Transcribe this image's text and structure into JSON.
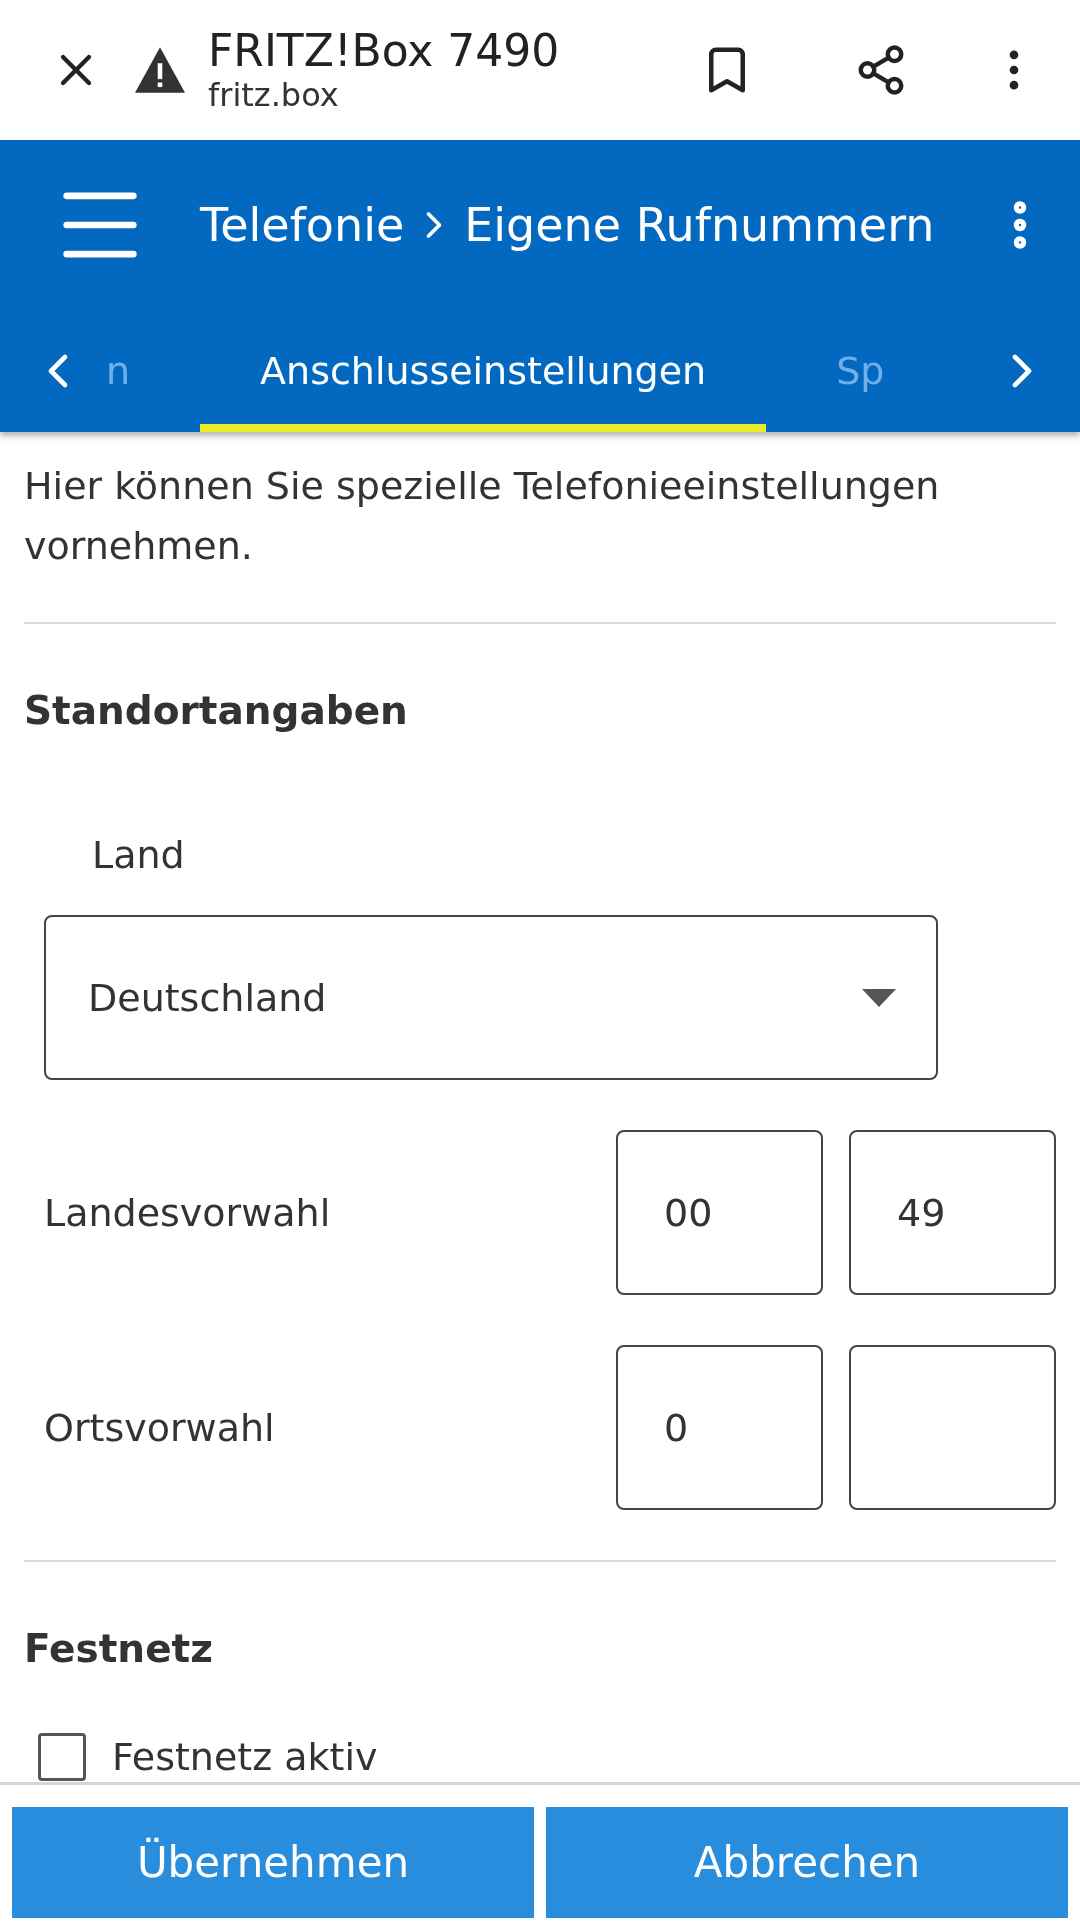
{
  "browser_bar": {
    "title": "FRITZ!Box 7490",
    "url": "fritz.box"
  },
  "app_bar": {
    "breadcrumb": [
      "Telefonie",
      "Eigene Rufnummern"
    ]
  },
  "tabs": [
    {
      "label": "n",
      "selected": false
    },
    {
      "label": "Anschlusseinstellungen",
      "selected": true
    },
    {
      "label": "Sp",
      "selected": false
    }
  ],
  "intro": "Hier können Sie spezielle Telefonieeinstellungen vornehmen.",
  "location": {
    "heading": "Standortangaben",
    "country_label": "Land",
    "country_value": "Deutschland",
    "rows": [
      {
        "label": "Landesvorwahl",
        "fields": [
          {
            "kind": "filled",
            "value": "00"
          },
          {
            "kind": "filled",
            "value": "49"
          }
        ]
      },
      {
        "label": "Ortsvorwahl",
        "fields": [
          {
            "kind": "filled",
            "value": "0"
          },
          {
            "kind": "blank"
          }
        ]
      }
    ]
  },
  "landline": {
    "heading": "Festnetz",
    "checkbox": {
      "label": "Festnetz aktiv",
      "checked": false
    }
  },
  "buttons": [
    "Übernehmen",
    "Abbrechen"
  ]
}
